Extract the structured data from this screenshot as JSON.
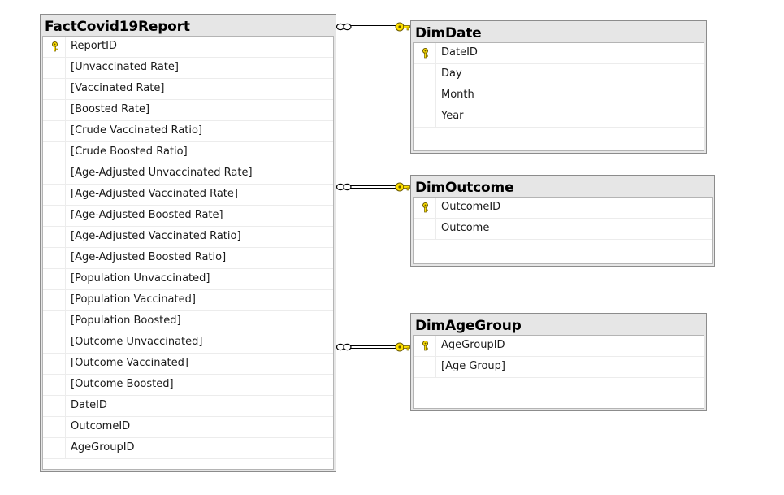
{
  "tables": {
    "fact": {
      "name": "FactCovid19Report",
      "columns": [
        {
          "name": "ReportID",
          "pk": true
        },
        {
          "name": "[Unvaccinated Rate]",
          "pk": false
        },
        {
          "name": "[Vaccinated Rate]",
          "pk": false
        },
        {
          "name": "[Boosted Rate]",
          "pk": false
        },
        {
          "name": "[Crude Vaccinated Ratio]",
          "pk": false
        },
        {
          "name": "[Crude Boosted Ratio]",
          "pk": false
        },
        {
          "name": "[Age-Adjusted Unvaccinated Rate]",
          "pk": false
        },
        {
          "name": "[Age-Adjusted Vaccinated Rate]",
          "pk": false
        },
        {
          "name": "[Age-Adjusted Boosted Rate]",
          "pk": false
        },
        {
          "name": "[Age-Adjusted Vaccinated Ratio]",
          "pk": false
        },
        {
          "name": "[Age-Adjusted Boosted Ratio]",
          "pk": false
        },
        {
          "name": "[Population Unvaccinated]",
          "pk": false
        },
        {
          "name": "[Population Vaccinated]",
          "pk": false
        },
        {
          "name": "[Population Boosted]",
          "pk": false
        },
        {
          "name": "[Outcome Unvaccinated]",
          "pk": false
        },
        {
          "name": "[Outcome Vaccinated]",
          "pk": false
        },
        {
          "name": "[Outcome Boosted]",
          "pk": false
        },
        {
          "name": "DateID",
          "pk": false
        },
        {
          "name": "OutcomeID",
          "pk": false
        },
        {
          "name": "AgeGroupID",
          "pk": false
        }
      ]
    },
    "date": {
      "name": "DimDate",
      "columns": [
        {
          "name": "DateID",
          "pk": true
        },
        {
          "name": "Day",
          "pk": false
        },
        {
          "name": "Month",
          "pk": false
        },
        {
          "name": "Year",
          "pk": false
        }
      ]
    },
    "outcome": {
      "name": "DimOutcome",
      "columns": [
        {
          "name": "OutcomeID",
          "pk": true
        },
        {
          "name": "Outcome",
          "pk": false
        }
      ]
    },
    "agegroup": {
      "name": "DimAgeGroup",
      "columns": [
        {
          "name": "AgeGroupID",
          "pk": true
        },
        {
          "name": "[Age Group]",
          "pk": false
        }
      ]
    }
  },
  "relationships": [
    {
      "from": "fact",
      "to": "date",
      "many_side": "infinity-icon",
      "one_side": "key-icon"
    },
    {
      "from": "fact",
      "to": "outcome",
      "many_side": "infinity-icon",
      "one_side": "key-icon"
    },
    {
      "from": "fact",
      "to": "agegroup",
      "many_side": "infinity-icon",
      "one_side": "key-icon"
    }
  ],
  "colors": {
    "key": "#ffe000",
    "key_outline": "#6b5a00",
    "line": "#000000",
    "title_bg": "#e6e6e6"
  }
}
